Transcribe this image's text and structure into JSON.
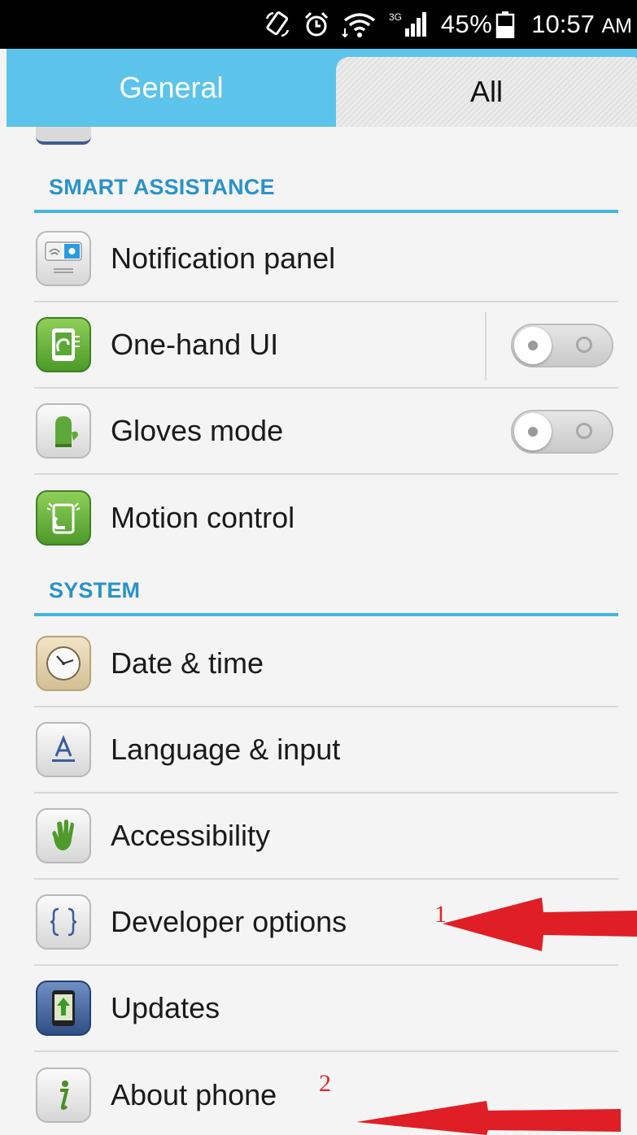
{
  "status_bar": {
    "battery": "45%",
    "time": "10:57",
    "ampm": "AM",
    "network": "3G",
    "icons": [
      "rotation-icon",
      "alarm-icon",
      "wifi-icon",
      "signal-icon",
      "battery-icon"
    ]
  },
  "tabs": [
    {
      "label": "General",
      "active": true
    },
    {
      "label": "All",
      "active": false
    }
  ],
  "sections": [
    {
      "title": "SMART ASSISTANCE",
      "items": [
        {
          "label": "Notification panel",
          "icon": "notification-panel-icon"
        },
        {
          "label": "One-hand UI",
          "icon": "one-hand-icon",
          "toggle": "off"
        },
        {
          "label": "Gloves mode",
          "icon": "glove-icon",
          "toggle": "off"
        },
        {
          "label": "Motion control",
          "icon": "motion-control-icon"
        }
      ]
    },
    {
      "title": "SYSTEM",
      "items": [
        {
          "label": "Date & time",
          "icon": "clock-icon"
        },
        {
          "label": "Language & input",
          "icon": "language-icon"
        },
        {
          "label": "Accessibility",
          "icon": "hand-icon"
        },
        {
          "label": "Developer options",
          "icon": "braces-icon"
        },
        {
          "label": "Updates",
          "icon": "updates-icon"
        },
        {
          "label": "About phone",
          "icon": "info-icon"
        }
      ]
    }
  ],
  "annotations": [
    {
      "label": "1",
      "target": "Developer options"
    },
    {
      "label": "2",
      "target": "About phone"
    }
  ],
  "colors": {
    "accent": "#5cc4ea",
    "section_text": "#2a93c7",
    "annotation": "#e0252b"
  }
}
